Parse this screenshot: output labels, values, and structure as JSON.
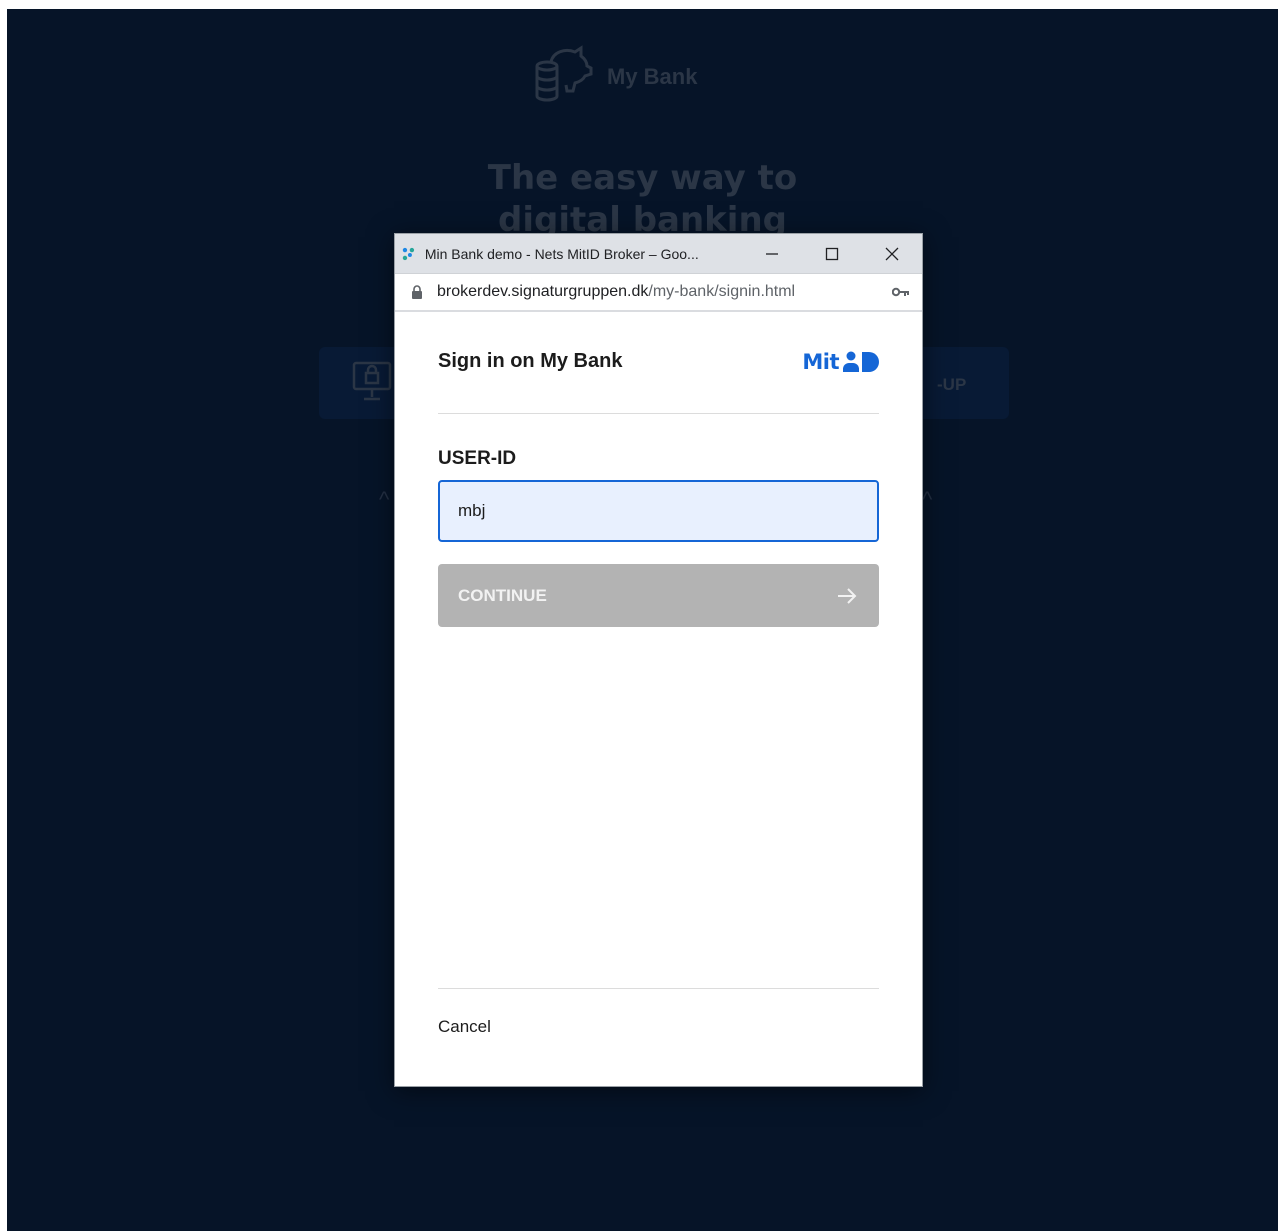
{
  "background": {
    "brand": "My Bank",
    "headline_line1": "The easy way to",
    "headline_line2": "digital banking",
    "signup_fragment": "-UP"
  },
  "window": {
    "title": "Min Bank demo - Nets MitID Broker – Goo...",
    "address_host": "brokerdev.signaturgruppen.dk",
    "address_path": "/my-bank/signin.html",
    "minimize_icon": "minimize-icon",
    "maximize_icon": "maximize-icon",
    "close_icon": "close-icon"
  },
  "signin": {
    "title": "Sign in on My Bank",
    "logo_text": "Mit",
    "userid_label": "USER-ID",
    "userid_value": "mbj",
    "continue_label": "CONTINUE",
    "cancel_label": "Cancel"
  },
  "colors": {
    "accent": "#1566d6",
    "background_overlay": "#061428",
    "button_disabled": "#b3b3b3"
  }
}
